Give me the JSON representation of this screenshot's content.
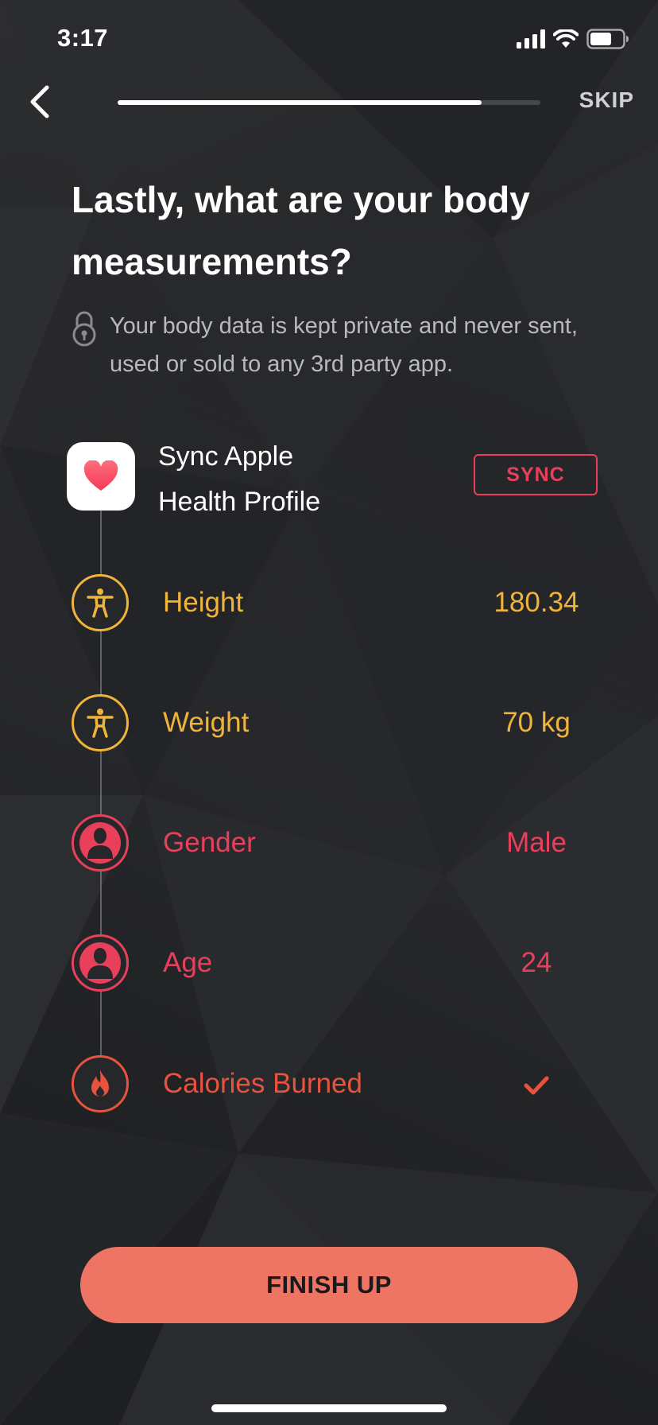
{
  "status_bar": {
    "time": "3:17",
    "icons": [
      "cellular-signal-icon",
      "wifi-icon",
      "battery-icon"
    ]
  },
  "nav": {
    "back_icon": "chevron-left-icon",
    "skip_label": "SKIP",
    "progress": 0.86
  },
  "header": {
    "title_line1": "Lastly, what are your body",
    "title_line2": "measurements?",
    "privacy_icon": "lock-icon",
    "privacy_line1": "Your body data is kept private and never sent,",
    "privacy_line2": "used or sold to any 3rd party app."
  },
  "sync": {
    "app_icon": "apple-health-heart-icon",
    "title_line1": "Sync Apple",
    "title_line2": "Health Profile",
    "button_label": "SYNC"
  },
  "metrics": [
    {
      "icon": "accessibility-figure-icon",
      "label": "Height",
      "value": "180.34",
      "color": "#f0b43a"
    },
    {
      "icon": "accessibility-figure-icon",
      "label": "Weight",
      "value": "70 kg",
      "color": "#f0b43a"
    },
    {
      "icon": "person-silhouette-icon",
      "label": "Gender",
      "value": "Male",
      "color": "#e8405a"
    },
    {
      "icon": "person-silhouette-icon",
      "label": "Age",
      "value": "24",
      "color": "#e8405a"
    },
    {
      "icon": "flame-icon",
      "label": "Calories Burned",
      "value_icon": "checkmark-icon",
      "color": "#e8533f"
    }
  ],
  "footer": {
    "finish_label": "FINISH UP"
  },
  "colors": {
    "background": "#26272a",
    "accent_yellow": "#f0b43a",
    "accent_pink": "#e8405a",
    "accent_red": "#e8533f",
    "button": "#ee7563"
  }
}
